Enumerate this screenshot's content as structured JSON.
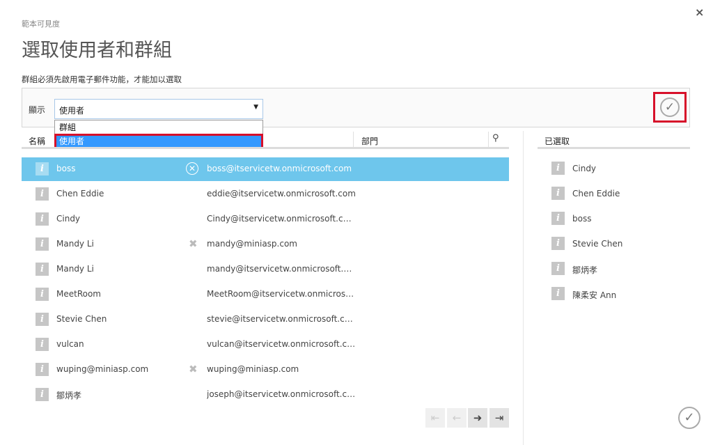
{
  "window": {
    "close_icon": "×"
  },
  "header": {
    "subtitle": "範本可見度",
    "title": "選取使用者和群組",
    "note": "群組必須先啟用電子郵件功能，才能加以選取"
  },
  "filter": {
    "show_label": "顯示",
    "selected_value": "使用者",
    "arrow": "▼",
    "options": [
      "群組",
      "使用者"
    ]
  },
  "confirm_icon": "✓",
  "table": {
    "columns": {
      "name": "名稱",
      "department": "部門"
    },
    "search_icon": "⚲",
    "remove_icon": "✕",
    "warn_icon": "✖",
    "info_icon": "i",
    "rows": [
      {
        "name": "boss",
        "email": "boss@itservicetw.onmicrosoft.com"
      },
      {
        "name": "Chen Eddie",
        "email": "eddie@itservicetw.onmicrosoft.com"
      },
      {
        "name": "Cindy",
        "email": "Cindy@itservicetw.onmicrosoft.com"
      },
      {
        "name": "Mandy Li",
        "email": "mandy@miniasp.com"
      },
      {
        "name": "Mandy Li",
        "email": "mandy@itservicetw.onmicrosoft.com"
      },
      {
        "name": "MeetRoom",
        "email": "MeetRoom@itservicetw.onmicrosoft.c..."
      },
      {
        "name": "Stevie Chen",
        "email": "stevie@itservicetw.onmicrosoft.com"
      },
      {
        "name": "vulcan",
        "email": "vulcan@itservicetw.onmicrosoft.com"
      },
      {
        "name": "wuping@miniasp.com",
        "email": "wuping@miniasp.com"
      },
      {
        "name": "鄒炳孝",
        "email": "joseph@itservicetw.onmicrosoft.com"
      }
    ]
  },
  "selected_panel": {
    "header": "已選取",
    "items": [
      "Cindy",
      "Chen Eddie",
      "boss",
      "Stevie Chen",
      "鄒炳孝",
      "陳柔安 Ann"
    ]
  },
  "pager": {
    "first": "⇤",
    "prev": "←",
    "next": "➜",
    "last": "⇥"
  },
  "colors": {
    "selected_row": "#6ec6ec",
    "highlight_outline": "#d7102a",
    "dropdown_highlight": "#3399ff"
  }
}
